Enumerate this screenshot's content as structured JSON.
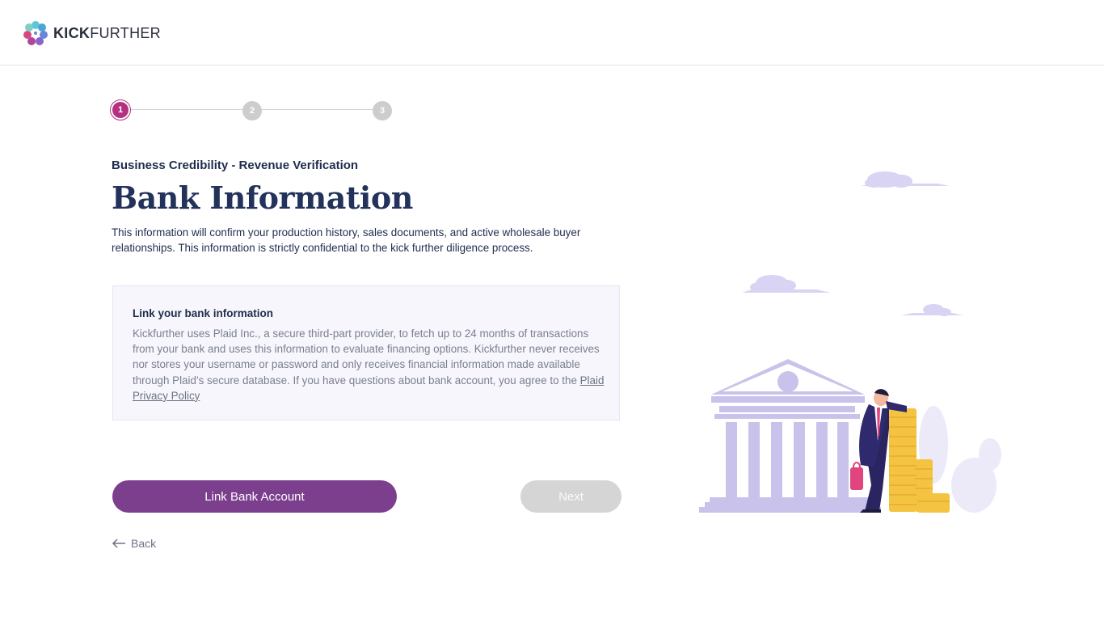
{
  "brand": {
    "name_bold": "KICK",
    "name_rest": "FURTHER"
  },
  "stepper": {
    "steps": [
      "1",
      "2",
      "3"
    ],
    "active": 1
  },
  "page": {
    "subtitle": "Business Credibility - Revenue Verification",
    "title": "Bank Information",
    "intro": "This information will confirm your production history, sales documents, and active wholesale buyer relationships. This information is strictly confidential to the kick further diligence process."
  },
  "info": {
    "title": "Link your bank information",
    "body": "Kickfurther uses Plaid Inc., a secure third-part provider, to fetch up to 24 months of transactions from your bank and uses this information to evaluate financing options. Kickfurther never receives nor stores your username or password and only receives financial information made available through Plaid’s secure database. If you have questions about bank account, you agree to the ",
    "link_text": "Plaid Privacy Policy"
  },
  "actions": {
    "link_bank_label": "Link Bank Account",
    "next_label": "Next",
    "back_label": "Back"
  },
  "colors": {
    "accent": "#7b3f8e",
    "step_active": "#b5307e",
    "disabled": "#d5d5d6",
    "illustration": "#c9c3ec"
  },
  "icons": {
    "logo": "kickfurther-logo-icon",
    "back": "arrow-left-icon",
    "illustration": "bank-building-businessman-illustration"
  }
}
